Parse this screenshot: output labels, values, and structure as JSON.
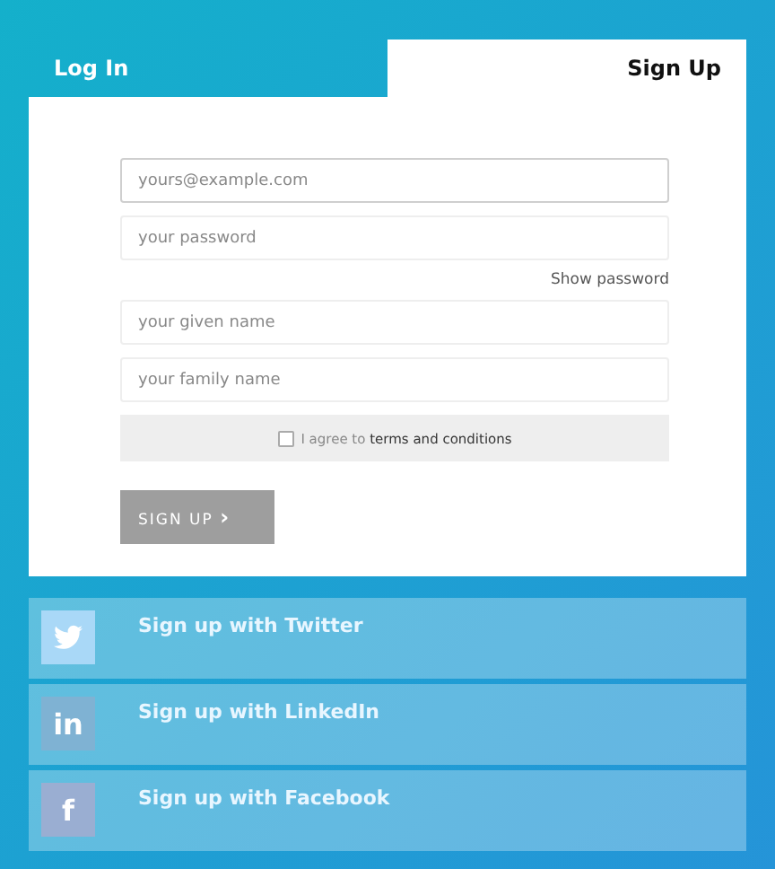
{
  "tabs": [
    {
      "label": "Log In",
      "selected": false
    },
    {
      "label": "Sign Up",
      "selected": true
    }
  ],
  "fields": [
    {
      "placeholder": "yours@example.com",
      "focused": true
    },
    {
      "placeholder": "your password",
      "focused": false
    },
    {
      "placeholder": "your given name",
      "focused": false
    },
    {
      "placeholder": "your family name",
      "focused": false
    }
  ],
  "show_password": "Show password",
  "terms": {
    "checked": false,
    "text": "I agree to",
    "link": "terms and conditions"
  },
  "submit": {
    "label": "SIGN UP",
    "icon": "›"
  },
  "social": [
    {
      "kind": "bird",
      "label": "Sign up with Twitter",
      "color": "#a9d8f7"
    },
    {
      "kind": "glyph",
      "glyph": "in",
      "label": "Sign up with LinkedIn",
      "color": "#7fb2d3"
    },
    {
      "kind": "glyph",
      "glyph": "f",
      "label": "Sign up with Facebook",
      "color": "#9aaed2"
    }
  ]
}
